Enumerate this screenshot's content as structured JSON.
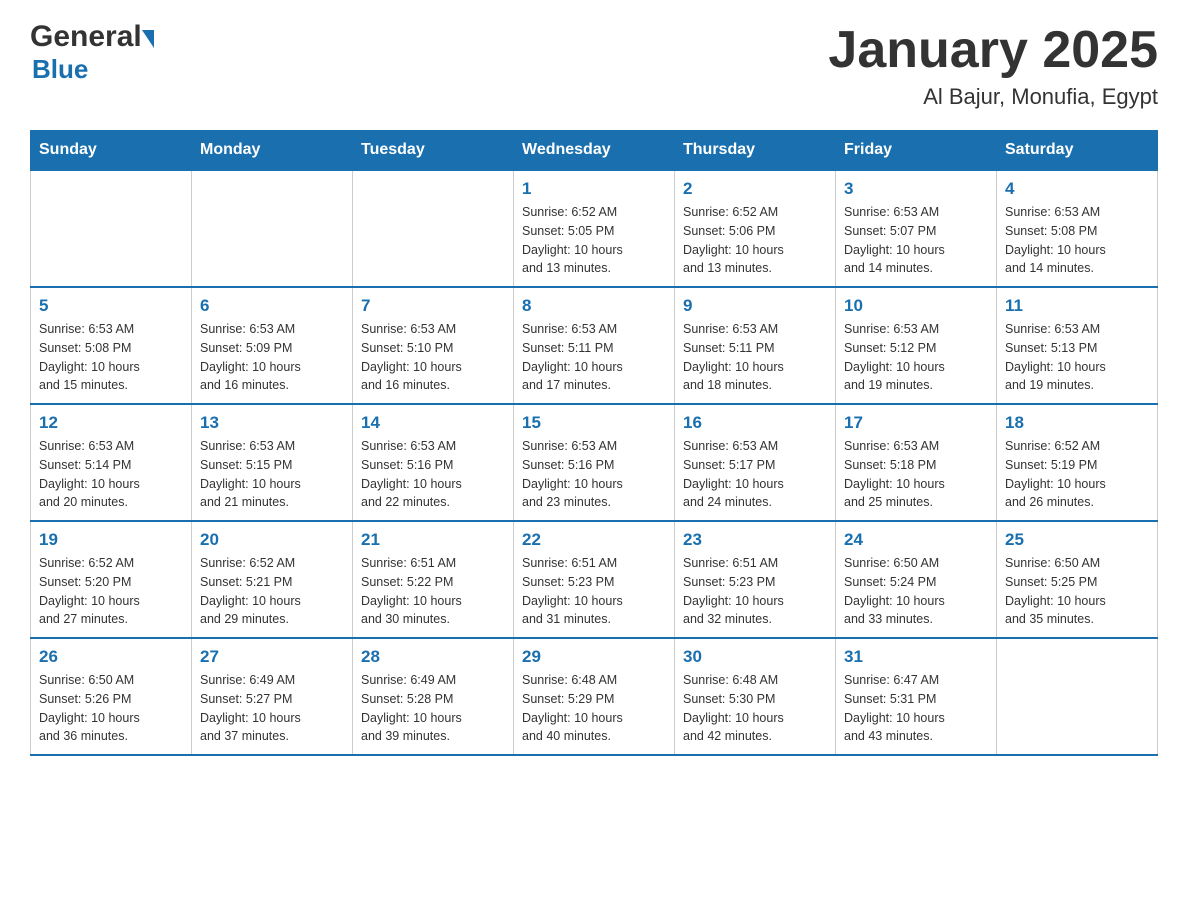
{
  "header": {
    "logo_part1": "General",
    "logo_part2": "Blue",
    "title": "January 2025",
    "subtitle": "Al Bajur, Monufia, Egypt"
  },
  "days_of_week": [
    "Sunday",
    "Monday",
    "Tuesday",
    "Wednesday",
    "Thursday",
    "Friday",
    "Saturday"
  ],
  "weeks": [
    [
      {
        "day": "",
        "info": ""
      },
      {
        "day": "",
        "info": ""
      },
      {
        "day": "",
        "info": ""
      },
      {
        "day": "1",
        "info": "Sunrise: 6:52 AM\nSunset: 5:05 PM\nDaylight: 10 hours\nand 13 minutes."
      },
      {
        "day": "2",
        "info": "Sunrise: 6:52 AM\nSunset: 5:06 PM\nDaylight: 10 hours\nand 13 minutes."
      },
      {
        "day": "3",
        "info": "Sunrise: 6:53 AM\nSunset: 5:07 PM\nDaylight: 10 hours\nand 14 minutes."
      },
      {
        "day": "4",
        "info": "Sunrise: 6:53 AM\nSunset: 5:08 PM\nDaylight: 10 hours\nand 14 minutes."
      }
    ],
    [
      {
        "day": "5",
        "info": "Sunrise: 6:53 AM\nSunset: 5:08 PM\nDaylight: 10 hours\nand 15 minutes."
      },
      {
        "day": "6",
        "info": "Sunrise: 6:53 AM\nSunset: 5:09 PM\nDaylight: 10 hours\nand 16 minutes."
      },
      {
        "day": "7",
        "info": "Sunrise: 6:53 AM\nSunset: 5:10 PM\nDaylight: 10 hours\nand 16 minutes."
      },
      {
        "day": "8",
        "info": "Sunrise: 6:53 AM\nSunset: 5:11 PM\nDaylight: 10 hours\nand 17 minutes."
      },
      {
        "day": "9",
        "info": "Sunrise: 6:53 AM\nSunset: 5:11 PM\nDaylight: 10 hours\nand 18 minutes."
      },
      {
        "day": "10",
        "info": "Sunrise: 6:53 AM\nSunset: 5:12 PM\nDaylight: 10 hours\nand 19 minutes."
      },
      {
        "day": "11",
        "info": "Sunrise: 6:53 AM\nSunset: 5:13 PM\nDaylight: 10 hours\nand 19 minutes."
      }
    ],
    [
      {
        "day": "12",
        "info": "Sunrise: 6:53 AM\nSunset: 5:14 PM\nDaylight: 10 hours\nand 20 minutes."
      },
      {
        "day": "13",
        "info": "Sunrise: 6:53 AM\nSunset: 5:15 PM\nDaylight: 10 hours\nand 21 minutes."
      },
      {
        "day": "14",
        "info": "Sunrise: 6:53 AM\nSunset: 5:16 PM\nDaylight: 10 hours\nand 22 minutes."
      },
      {
        "day": "15",
        "info": "Sunrise: 6:53 AM\nSunset: 5:16 PM\nDaylight: 10 hours\nand 23 minutes."
      },
      {
        "day": "16",
        "info": "Sunrise: 6:53 AM\nSunset: 5:17 PM\nDaylight: 10 hours\nand 24 minutes."
      },
      {
        "day": "17",
        "info": "Sunrise: 6:53 AM\nSunset: 5:18 PM\nDaylight: 10 hours\nand 25 minutes."
      },
      {
        "day": "18",
        "info": "Sunrise: 6:52 AM\nSunset: 5:19 PM\nDaylight: 10 hours\nand 26 minutes."
      }
    ],
    [
      {
        "day": "19",
        "info": "Sunrise: 6:52 AM\nSunset: 5:20 PM\nDaylight: 10 hours\nand 27 minutes."
      },
      {
        "day": "20",
        "info": "Sunrise: 6:52 AM\nSunset: 5:21 PM\nDaylight: 10 hours\nand 29 minutes."
      },
      {
        "day": "21",
        "info": "Sunrise: 6:51 AM\nSunset: 5:22 PM\nDaylight: 10 hours\nand 30 minutes."
      },
      {
        "day": "22",
        "info": "Sunrise: 6:51 AM\nSunset: 5:23 PM\nDaylight: 10 hours\nand 31 minutes."
      },
      {
        "day": "23",
        "info": "Sunrise: 6:51 AM\nSunset: 5:23 PM\nDaylight: 10 hours\nand 32 minutes."
      },
      {
        "day": "24",
        "info": "Sunrise: 6:50 AM\nSunset: 5:24 PM\nDaylight: 10 hours\nand 33 minutes."
      },
      {
        "day": "25",
        "info": "Sunrise: 6:50 AM\nSunset: 5:25 PM\nDaylight: 10 hours\nand 35 minutes."
      }
    ],
    [
      {
        "day": "26",
        "info": "Sunrise: 6:50 AM\nSunset: 5:26 PM\nDaylight: 10 hours\nand 36 minutes."
      },
      {
        "day": "27",
        "info": "Sunrise: 6:49 AM\nSunset: 5:27 PM\nDaylight: 10 hours\nand 37 minutes."
      },
      {
        "day": "28",
        "info": "Sunrise: 6:49 AM\nSunset: 5:28 PM\nDaylight: 10 hours\nand 39 minutes."
      },
      {
        "day": "29",
        "info": "Sunrise: 6:48 AM\nSunset: 5:29 PM\nDaylight: 10 hours\nand 40 minutes."
      },
      {
        "day": "30",
        "info": "Sunrise: 6:48 AM\nSunset: 5:30 PM\nDaylight: 10 hours\nand 42 minutes."
      },
      {
        "day": "31",
        "info": "Sunrise: 6:47 AM\nSunset: 5:31 PM\nDaylight: 10 hours\nand 43 minutes."
      },
      {
        "day": "",
        "info": ""
      }
    ]
  ]
}
